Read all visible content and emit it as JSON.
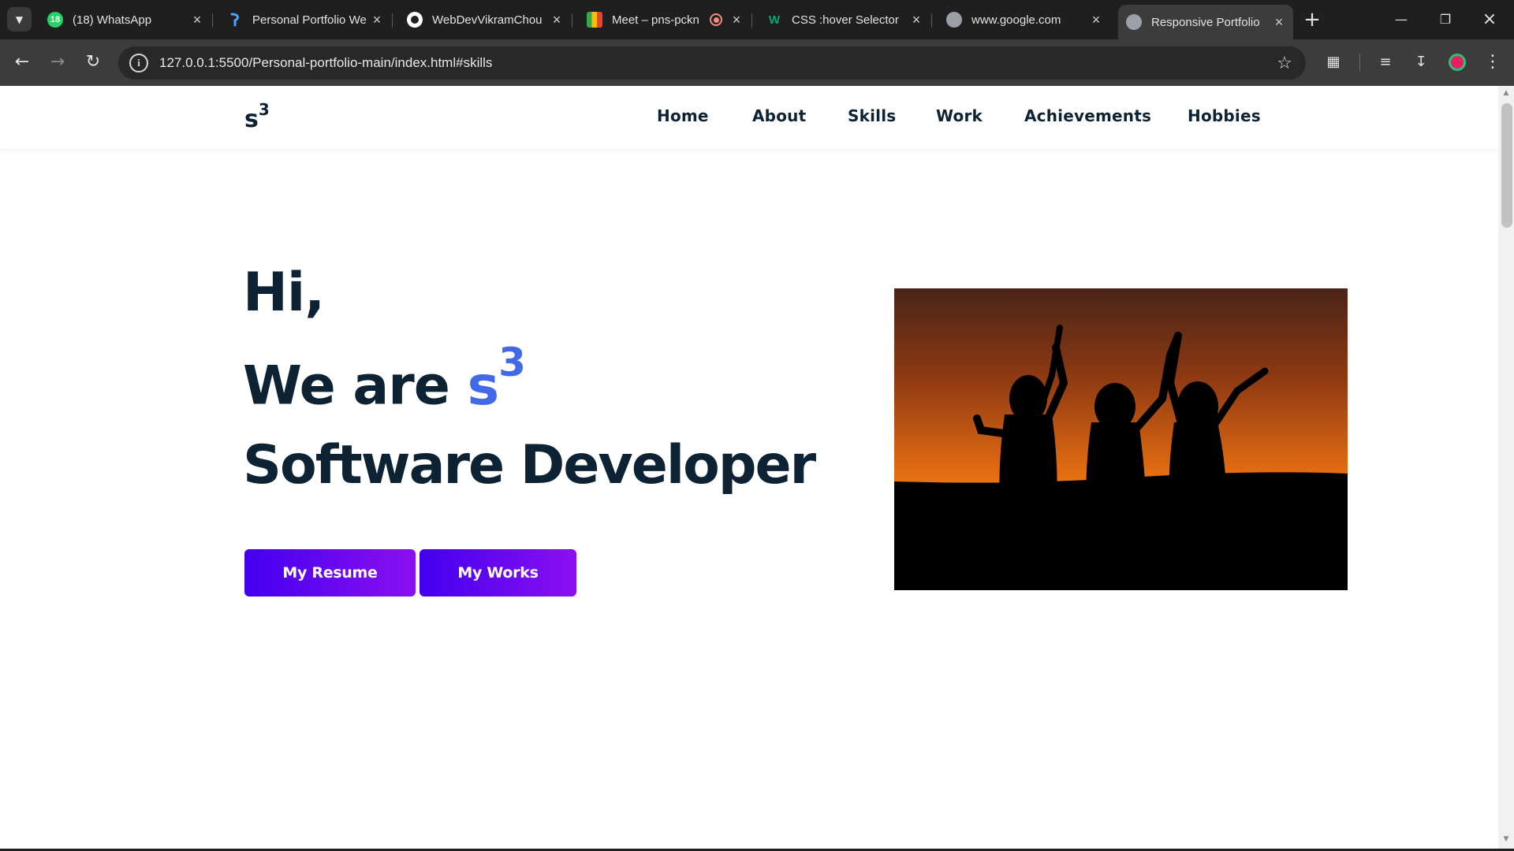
{
  "browser": {
    "tabs": [
      {
        "title": "(18) WhatsApp",
        "badge": "18",
        "favicon": "whatsapp-icon",
        "active": false
      },
      {
        "title": "Personal Portfolio We",
        "favicon": "portfolio-site-icon",
        "active": false
      },
      {
        "title": "WebDevVikramChou",
        "favicon": "github-icon",
        "active": false
      },
      {
        "title": "Meet – pns-pckn",
        "favicon": "google-meet-icon",
        "active": false
      },
      {
        "title": "CSS :hover Selector",
        "favicon": "w3schools-icon",
        "active": false
      },
      {
        "title": "www.google.com",
        "favicon": "globe-icon",
        "active": false
      },
      {
        "title": "Responsive Portfolio",
        "favicon": "globe-icon",
        "active": true
      }
    ],
    "url": "127.0.0.1:5500/Personal-portfolio-main/index.html#skills",
    "colors": {
      "tabstrip": "#1f1f1f",
      "toolbar": "#3c3c3c",
      "omnibox": "#282828"
    }
  },
  "site": {
    "logo": {
      "text": "s",
      "sup": "3"
    },
    "nav": [
      "Home",
      "About",
      "Skills",
      "Work",
      "Achievements",
      "Hobbies"
    ],
    "hero": {
      "greeting": "Hi,",
      "intro": "We are ",
      "brand": "s",
      "brand_sup": "3",
      "role": "Software Developer"
    },
    "buttons": {
      "resume": "My Resume",
      "works": "My Works"
    },
    "colors": {
      "text": "#0d2233",
      "accent": "#4169e8",
      "button_start": "#4200f0",
      "button_end": "#8b10f0"
    }
  }
}
